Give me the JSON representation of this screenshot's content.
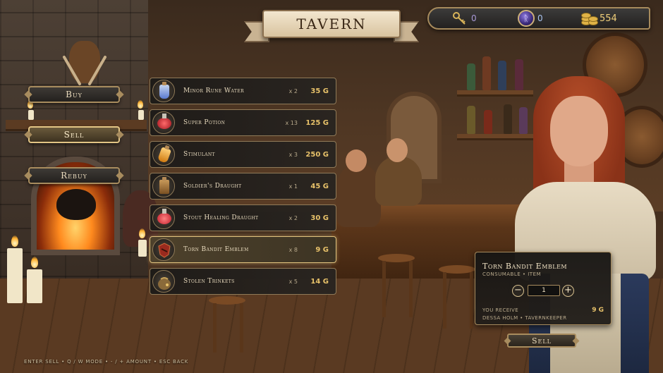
{
  "screen": {
    "title": "Tavern"
  },
  "resources": {
    "keys": "0",
    "orbs": "0",
    "gold": "554",
    "key_icon": "key-icon",
    "orb_icon": "rune-orb-icon",
    "gold_icon": "gold-coins-icon"
  },
  "tabs": [
    {
      "label": "Buy",
      "active": false
    },
    {
      "label": "Sell",
      "active": true
    },
    {
      "label": "Rebuy",
      "active": false
    }
  ],
  "items": [
    {
      "name": "Minor Rune Water",
      "qty": "x 2",
      "price": "35 G",
      "icon": "blue-vial-icon",
      "selected": false
    },
    {
      "name": "Super Potion",
      "qty": "x 13",
      "price": "125 G",
      "icon": "red-flask-icon",
      "selected": false
    },
    {
      "name": "Stimulant",
      "qty": "x 3",
      "price": "250 G",
      "icon": "orange-vial-icon",
      "selected": false
    },
    {
      "name": "Soldier's Draught",
      "qty": "x 1",
      "price": "45 G",
      "icon": "tankard-icon",
      "selected": false
    },
    {
      "name": "Stout Healing Draught",
      "qty": "x 2",
      "price": "30 G",
      "icon": "red-round-flask-icon",
      "selected": false
    },
    {
      "name": "Torn Bandit Emblem",
      "qty": "x 8",
      "price": "9 G",
      "icon": "emblem-icon",
      "selected": true
    },
    {
      "name": "Stolen Trinkets",
      "qty": "x 5",
      "price": "14 G",
      "icon": "trinket-pouch-icon",
      "selected": false
    }
  ],
  "detail": {
    "title": "Torn Bandit Emblem",
    "subtitle": "Consumable • Item",
    "quantity": "1",
    "minus": "−",
    "plus": "+",
    "receive_label": "You receive",
    "receive_value": "9 G",
    "vendor": "Dessa Holm • Tavernkeeper"
  },
  "sell_button": "Sell",
  "hint": "Enter  Sell • Q / W  Mode • -  /  +  Amount • Esc  Back",
  "colors": {
    "gold": "#e8c26a",
    "frame": "#a88c5e",
    "panel": "#1c1a18",
    "text": "#eadcbf"
  }
}
